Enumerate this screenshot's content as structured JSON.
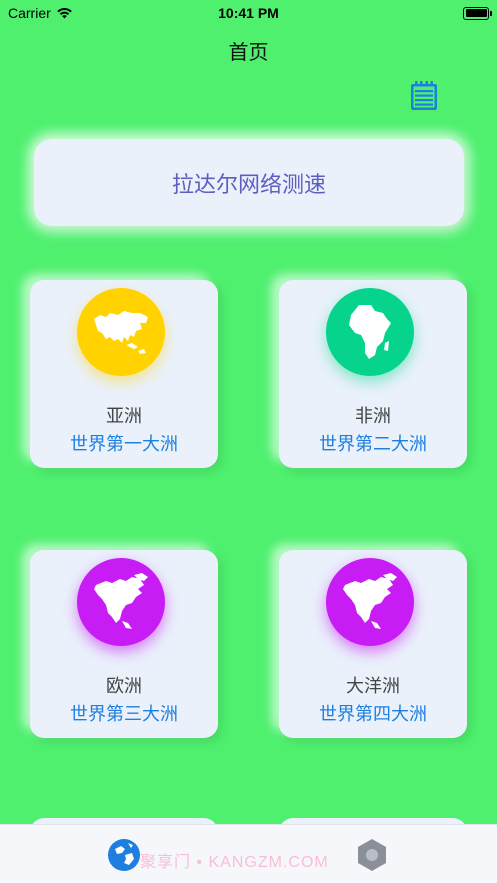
{
  "status_bar": {
    "carrier": "Carrier",
    "time": "10:41 PM"
  },
  "nav": {
    "title": "首页",
    "right_icon": "notes-icon"
  },
  "banner": {
    "label": "拉达尔网络测速"
  },
  "cards": [
    {
      "name": "亚洲",
      "subtitle": "世界第一大洲",
      "icon": "asia-map-icon",
      "color": "#ffd200"
    },
    {
      "name": "非洲",
      "subtitle": "世界第二大洲",
      "icon": "africa-map-icon",
      "color": "#07d48c"
    },
    {
      "name": "欧洲",
      "subtitle": "世界第三大洲",
      "icon": "north-america-map-icon",
      "color": "#c71cf3"
    },
    {
      "name": "大洋洲",
      "subtitle": "世界第四大洲",
      "icon": "north-america-map-icon",
      "color": "#c71cf3"
    }
  ],
  "tab_bar": {
    "tabs": [
      {
        "icon": "globe-icon"
      },
      {
        "icon": "hexagon-icon"
      }
    ]
  },
  "watermark": "聚享门 • KANGZM.COM",
  "colors": {
    "background": "#4ef06e",
    "card": "#eaf1fb",
    "accent_blue": "#1e7fe0",
    "banner_text": "#5d5fc0"
  }
}
